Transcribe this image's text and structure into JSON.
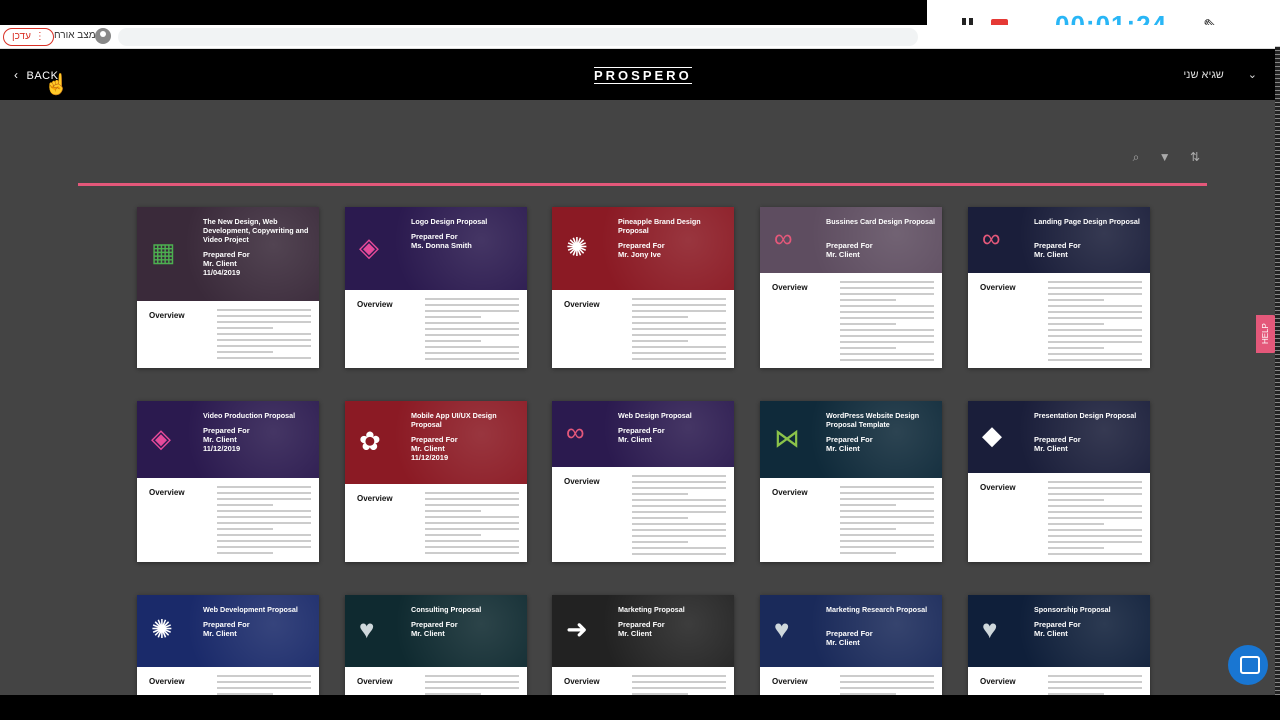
{
  "browser": {
    "update_label": "עדכן",
    "guest_label": "מצב אורח"
  },
  "recorder": {
    "time": "00:01:24"
  },
  "header": {
    "back_label": "BACK",
    "logo": "PROSPERO",
    "user_name": "שגיא שני"
  },
  "help_label": "HELP",
  "cards": [
    {
      "title": "The New Design, Web Development, Copywriting and Video Project",
      "prepared": "Prepared For",
      "client": "Mr. Client",
      "date": "11/04/2019",
      "overview": "Overview",
      "color": "#3a2a3a",
      "logo": "▦",
      "logo_color": "#4caf50",
      "height": 94
    },
    {
      "title": "Logo Design Proposal",
      "prepared": "Prepared For",
      "client": "Ms. Donna Smith",
      "date": "",
      "overview": "Overview",
      "color": "#2b1a4f",
      "logo": "◈",
      "logo_color": "#e64a9a",
      "height": 83
    },
    {
      "title": "Pineapple Brand Design Proposal",
      "prepared": "Prepared For",
      "client": "Mr. Jony Ive",
      "date": "",
      "overview": "Overview",
      "color": "#8b1a24",
      "logo": "✺",
      "logo_color": "#fff",
      "height": 83
    },
    {
      "title": "Bussines Card Design Proposal",
      "prepared": "Prepared For",
      "client": "Mr. Client",
      "date": "",
      "overview": "Overview",
      "color": "#5e4d60",
      "logo": "∞",
      "logo_color": "#e4587a",
      "height": 66
    },
    {
      "title": "Landing Page Design Proposal",
      "prepared": "Prepared For",
      "client": "Mr. Client",
      "date": "",
      "overview": "Overview",
      "color": "#1a1e3a",
      "logo": "∞",
      "logo_color": "#e4587a",
      "height": 66
    },
    {
      "title": "Video Production Proposal",
      "prepared": "Prepared For",
      "client": "Mr. Client",
      "date": "11/12/2019",
      "overview": "Overview",
      "color": "#2b1a4f",
      "logo": "◈",
      "logo_color": "#e64a9a",
      "height": 77
    },
    {
      "title": "Mobile App UI/UX Design Proposal",
      "prepared": "Prepared For",
      "client": "Mr. Client",
      "date": "11/12/2019",
      "overview": "Overview",
      "color": "#8b1a24",
      "logo": "✿",
      "logo_color": "#fff",
      "height": 83
    },
    {
      "title": "Web Design Proposal",
      "prepared": "Prepared For",
      "client": "Mr. Client",
      "date": "",
      "overview": "Overview",
      "color": "#2b1a4f",
      "logo": "∞",
      "logo_color": "#e4587a",
      "height": 66
    },
    {
      "title": "WordPress Website Design Proposal Template",
      "prepared": "Prepared For",
      "client": "Mr. Client",
      "date": "",
      "overview": "Overview",
      "color": "#0f2a3a",
      "logo": "⋈",
      "logo_color": "#8bc34a",
      "height": 77
    },
    {
      "title": "Presentation Design Proposal",
      "prepared": "Prepared For",
      "client": "Mr. Client",
      "date": "",
      "overview": "Overview",
      "color": "#1a1e3a",
      "logo": "◆",
      "logo_color": "#fff",
      "height": 72
    },
    {
      "title": "Web Development Proposal",
      "prepared": "Prepared For",
      "client": "Mr. Client",
      "date": "",
      "overview": "Overview",
      "color": "#1a2a6a",
      "logo": "✺",
      "logo_color": "#fff",
      "height": 72
    },
    {
      "title": "Consulting Proposal",
      "prepared": "Prepared For",
      "client": "Mr. Client",
      "date": "",
      "overview": "Overview",
      "color": "#0f2a30",
      "logo": "♥",
      "logo_color": "#cfd8dc",
      "height": 72
    },
    {
      "title": "Marketing Proposal",
      "prepared": "Prepared For",
      "client": "Mr. Client",
      "date": "",
      "overview": "Overview",
      "color": "#222",
      "logo": "➜",
      "logo_color": "#fff",
      "height": 72
    },
    {
      "title": "Marketing Research Proposal",
      "prepared": "Prepared For",
      "client": "Mr. Client",
      "date": "",
      "overview": "Overview",
      "color": "#1a2a5a",
      "logo": "♥",
      "logo_color": "#cfd8dc",
      "height": 72
    },
    {
      "title": "Sponsorship Proposal",
      "prepared": "Prepared For",
      "client": "Mr. Client",
      "date": "",
      "overview": "Overview",
      "color": "#0f1f3a",
      "logo": "♥",
      "logo_color": "#cfd8dc",
      "height": 72
    }
  ]
}
